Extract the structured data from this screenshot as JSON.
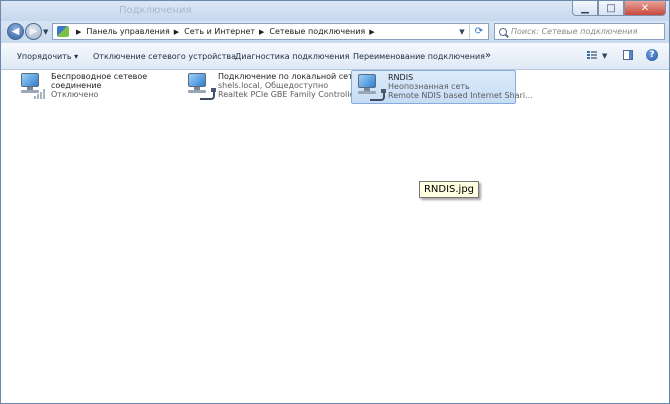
{
  "window": {
    "title": "Подключения",
    "minimize_icon": "minimize-icon",
    "maximize_icon": "maximize-icon",
    "close_icon": "close-icon"
  },
  "address": {
    "crumbs": [
      "Панель управления",
      "Сеть и Интернет",
      "Сетевые подключения"
    ]
  },
  "search": {
    "placeholder": "Поиск: Сетевые подключения"
  },
  "toolbar": {
    "organize_label": "Упорядочить",
    "disable_label": "Отключение сетевого устройства",
    "diagnose_label": "Диагностика подключения",
    "rename_label": "Переименование подключения",
    "more_label": "»"
  },
  "connections": [
    {
      "name": "Беспроводное сетевое",
      "name2": "соединение",
      "status": "Отключено",
      "device": "",
      "icon": "wireless-network-icon",
      "selected": false
    },
    {
      "name": "Подключение по локальной сети",
      "name2": "",
      "status": "shels.local, Общедоступно",
      "device": "Realtek PCIe GBE Family Controller",
      "icon": "lan-network-icon",
      "selected": false
    },
    {
      "name": "RNDIS",
      "name2": "",
      "status": "Неопознанная сеть",
      "device": "Remote NDIS based Internet Shari...",
      "icon": "lan-network-icon",
      "selected": true
    }
  ],
  "tooltip": {
    "text": "RNDIS.jpg"
  },
  "colors": {
    "selection": "#c6dcf5",
    "selection_border": "#84acdd",
    "signal_on": "#2c9a3c"
  }
}
